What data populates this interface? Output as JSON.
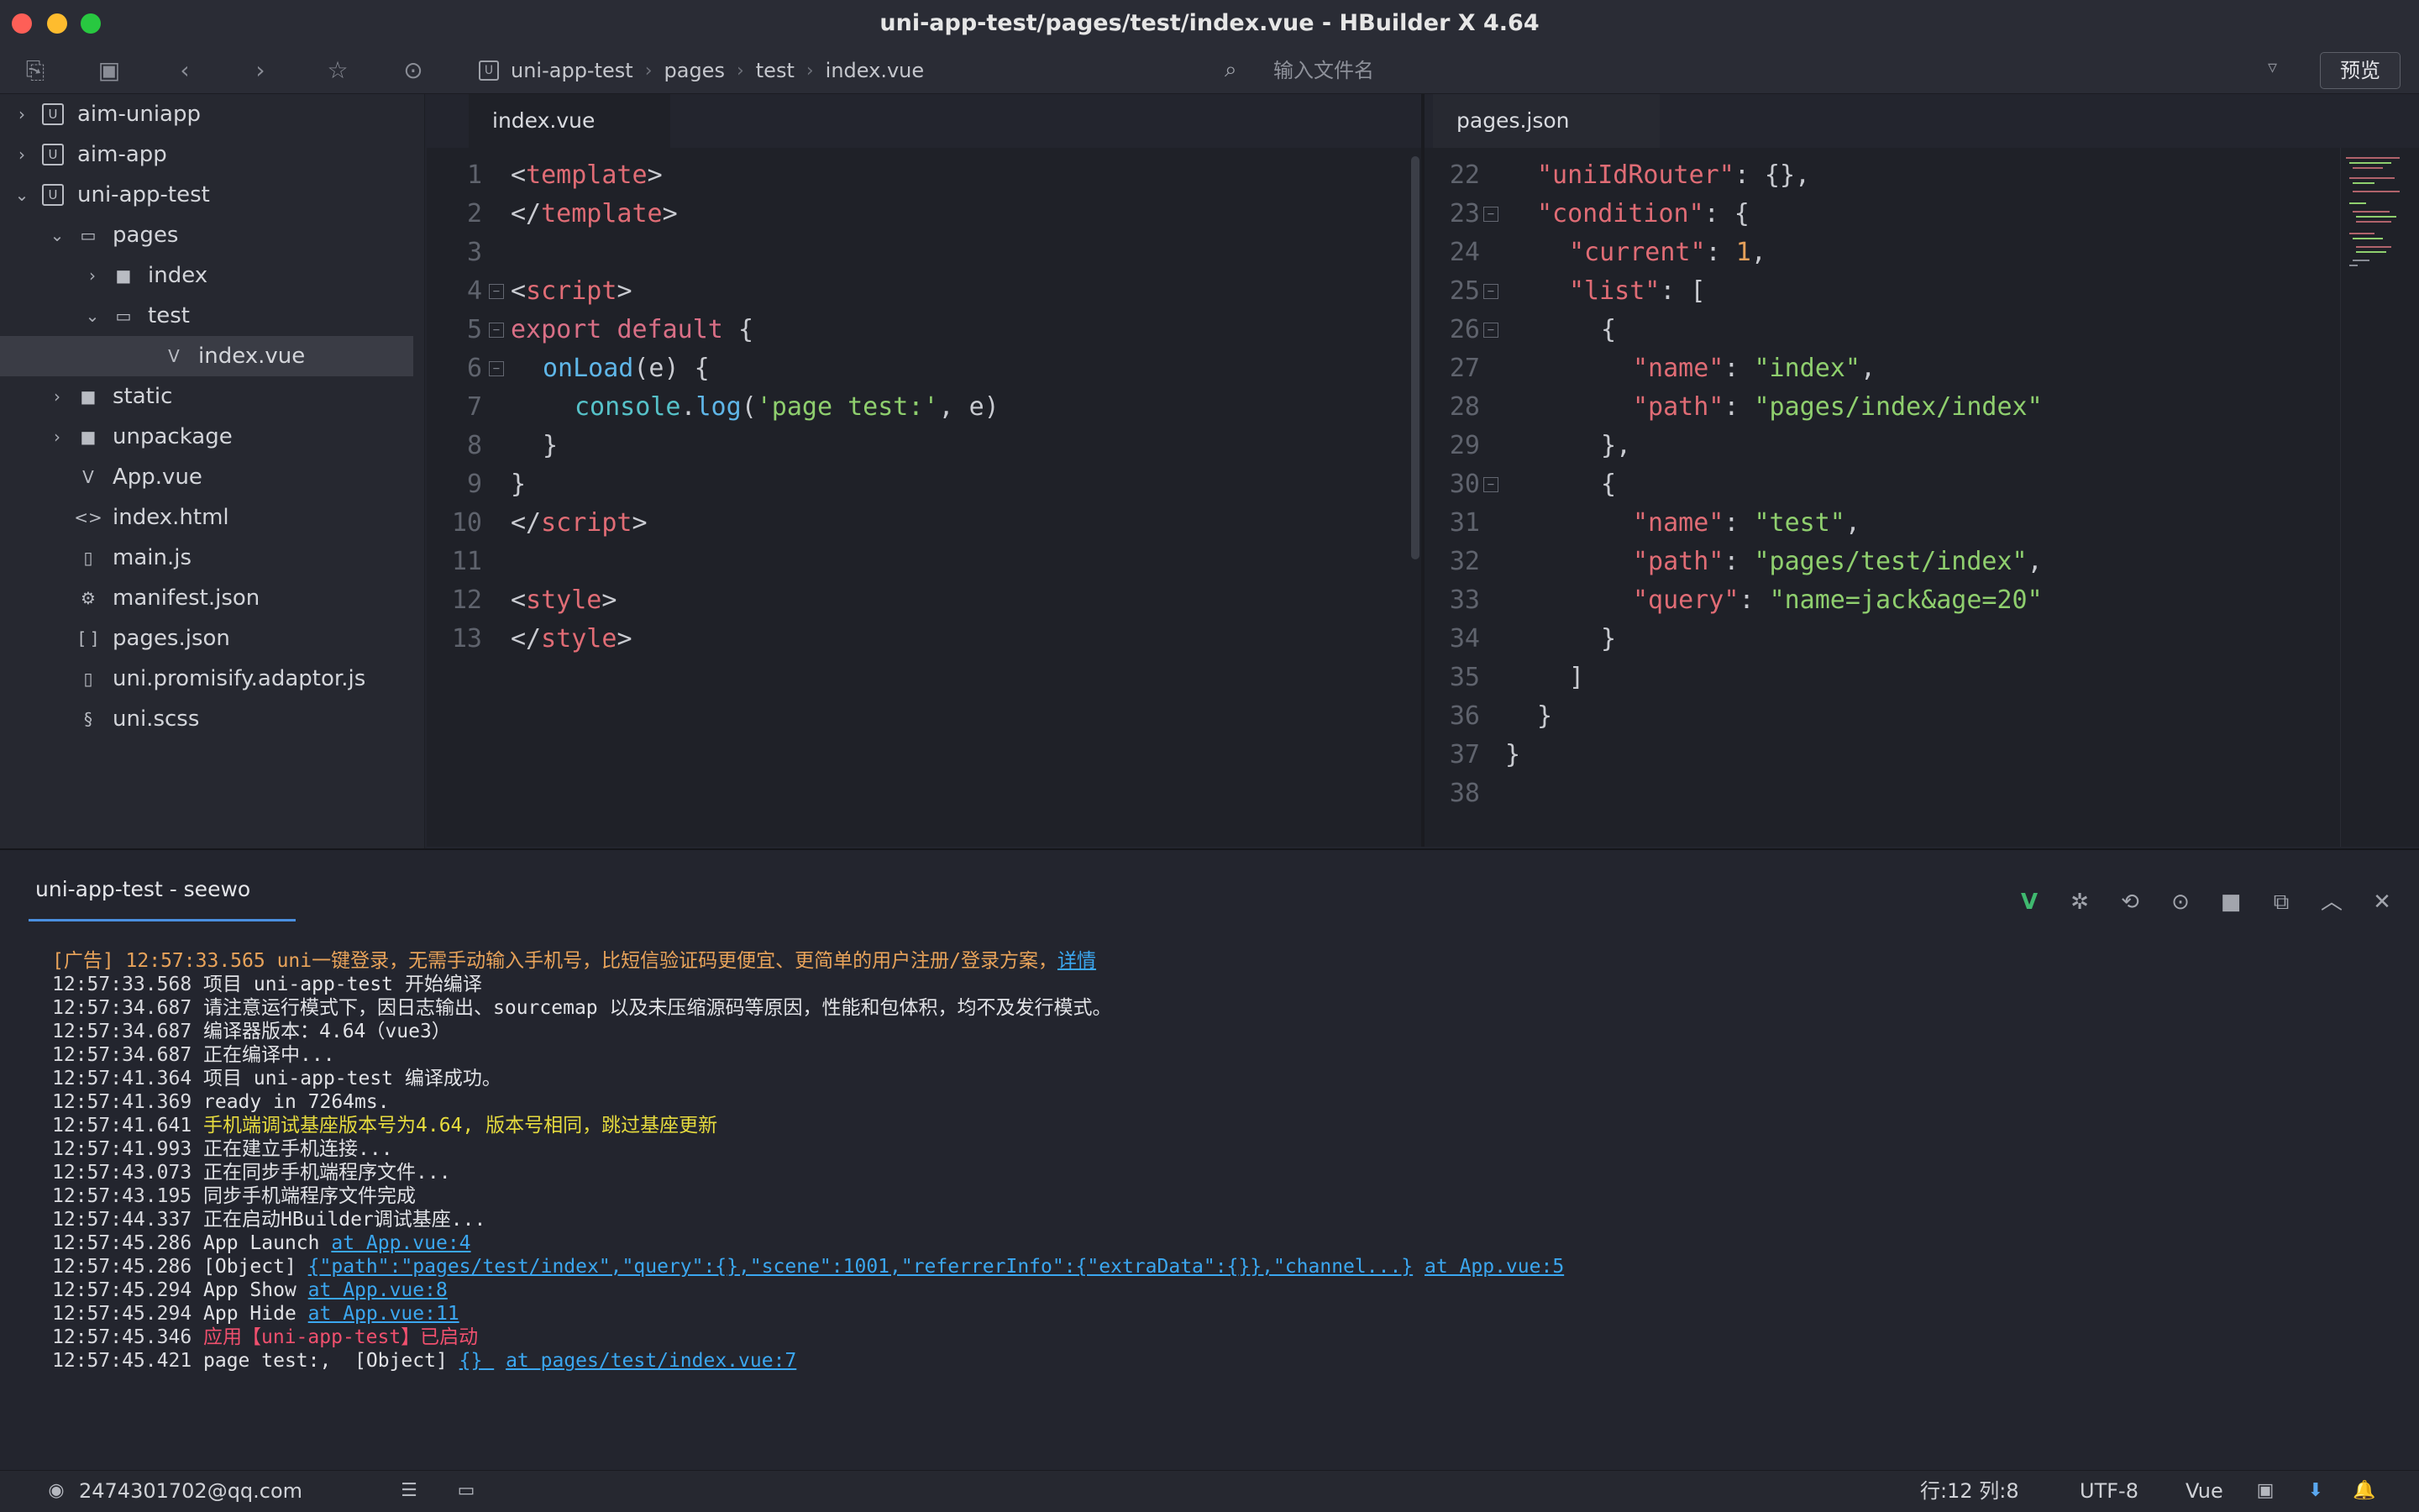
{
  "window": {
    "title": "uni-app-test/pages/test/index.vue - HBuilder X 4.64",
    "traffic_colors": {
      "close": "#fe5f57",
      "minimize": "#febc2e",
      "maximize": "#28c840"
    }
  },
  "toolbar": {
    "icons": [
      "new-file-icon",
      "save-icon",
      "back-icon",
      "forward-icon",
      "star-icon",
      "run-icon"
    ],
    "breadcrumb": [
      "uni-app-test",
      "pages",
      "test",
      "index.vue"
    ],
    "search_placeholder": "输入文件名",
    "preview_label": "预览"
  },
  "sidebar": {
    "items": [
      {
        "label": "aim-uniapp",
        "icon": "project-icon",
        "arrow": "›"
      },
      {
        "label": "aim-app",
        "icon": "project-icon",
        "arrow": "›"
      },
      {
        "label": "uni-app-test",
        "icon": "project-icon",
        "arrow": "⌄"
      },
      {
        "label": "pages",
        "icon": "folder-open-icon",
        "arrow": "⌄"
      },
      {
        "label": "index",
        "icon": "folder-icon",
        "arrow": "›"
      },
      {
        "label": "test",
        "icon": "folder-open-icon",
        "arrow": "⌄"
      },
      {
        "label": "index.vue",
        "icon": "vue-file-icon",
        "arrow": ""
      },
      {
        "label": "static",
        "icon": "folder-icon",
        "arrow": "›"
      },
      {
        "label": "unpackage",
        "icon": "folder-icon",
        "arrow": "›"
      },
      {
        "label": "App.vue",
        "icon": "vue-file-icon",
        "arrow": ""
      },
      {
        "label": "index.html",
        "icon": "html-file-icon",
        "arrow": ""
      },
      {
        "label": "main.js",
        "icon": "js-file-icon",
        "arrow": ""
      },
      {
        "label": "manifest.json",
        "icon": "manifest-file-icon",
        "arrow": ""
      },
      {
        "label": "pages.json",
        "icon": "json-file-icon",
        "arrow": ""
      },
      {
        "label": "uni.promisify.adaptor.js",
        "icon": "js-file-icon",
        "arrow": ""
      },
      {
        "label": "uni.scss",
        "icon": "scss-file-icon",
        "arrow": ""
      }
    ],
    "tools": [
      "project-manager-icon",
      "find-icon",
      "debug-icon",
      "git-icon",
      "cloud-icon"
    ]
  },
  "editor_left": {
    "tab": "index.vue",
    "line_numbers": [
      "1",
      "2",
      "3",
      "4",
      "5",
      "6",
      "7",
      "8",
      "9",
      "10",
      "11",
      "12",
      "13"
    ],
    "lines": {
      "l1_open": "<",
      "l1_tag": "template",
      "l1_close": ">",
      "l2_open": "</",
      "l2_tag": "template",
      "l2_close": ">",
      "l4_open": "<",
      "l4_tag": "script",
      "l4_close": ">",
      "l5_kw1": "export",
      "l5_kw2": "default",
      "l5_brace": "{",
      "l6_fn": "onLoad",
      "l6_args": "(e) {",
      "l7_obj": "console",
      "l7_dot": ".",
      "l7_fn": "log",
      "l7_p1": "(",
      "l7_str": "'page test:'",
      "l7_rest": ", e)",
      "l8": "}",
      "l9": "}",
      "l10_open": "</",
      "l10_tag": "script",
      "l10_close": ">",
      "l12_open": "<",
      "l12_tag": "style",
      "l12_close": ">",
      "l13_open": "</",
      "l13_tag": "style",
      "l13_close": ">"
    }
  },
  "editor_right": {
    "tab": "pages.json",
    "line_numbers": [
      "22",
      "23",
      "24",
      "25",
      "26",
      "27",
      "28",
      "29",
      "30",
      "31",
      "32",
      "33",
      "34",
      "35",
      "36",
      "37",
      "38"
    ],
    "lines": {
      "l22_key": "\"uniIdRouter\"",
      "l22_rest": ": {},",
      "l23_key": "\"condition\"",
      "l23_rest": ": {",
      "l24_key": "\"current\"",
      "l24_colon": ": ",
      "l24_num": "1",
      "l24_comma": ",",
      "l25_key": "\"list\"",
      "l25_rest": ": [",
      "l26": "{",
      "l27_key": "\"name\"",
      "l27_colon": ": ",
      "l27_val": "\"index\"",
      "l27_comma": ",",
      "l28_key": "\"path\"",
      "l28_colon": ": ",
      "l28_val": "\"pages/index/index\"",
      "l29": "},",
      "l30": "{",
      "l31_key": "\"name\"",
      "l31_colon": ": ",
      "l31_val": "\"test\"",
      "l31_comma": ",",
      "l32_key": "\"path\"",
      "l32_colon": ": ",
      "l32_val": "\"pages/test/index\"",
      "l32_comma": ",",
      "l33_key": "\"query\"",
      "l33_colon": ": ",
      "l33_val": "\"name=jack&age=20\"",
      "l34": "}",
      "l35": "]",
      "l36": "}",
      "l37": "}"
    }
  },
  "console": {
    "tab": "uni-app-test - seewo",
    "icons": [
      "vue-icon",
      "debug-icon",
      "restart-icon",
      "run-icon",
      "stop-icon",
      "open-external-icon",
      "collapse-icon",
      "clear-icon"
    ],
    "logs": [
      {
        "ts": "[广告] 12:57:33.565",
        "msg": " uni一键登录，无需手动输入手机号，比短信验证码更便宜、更简单的用户注册/登录方案，",
        "link": "详情"
      },
      {
        "ts": "12:57:33.568",
        "msg": " 项目 uni-app-test 开始编译"
      },
      {
        "ts": "12:57:34.687",
        "msg": " 请注意运行模式下，因日志输出、sourcemap 以及未压缩源码等原因，性能和包体积，均不及发行模式。"
      },
      {
        "ts": "12:57:34.687",
        "msg": " 编译器版本：4.64（vue3）"
      },
      {
        "ts": "12:57:34.687",
        "msg": " 正在编译中..."
      },
      {
        "ts": "12:57:41.364",
        "msg": " 项目 uni-app-test 编译成功。"
      },
      {
        "ts": "12:57:41.369",
        "msg": " ready in 7264ms."
      },
      {
        "ts": "12:57:41.641",
        "msg": " 手机端调试基座版本号为4.64, 版本号相同，跳过基座更新"
      },
      {
        "ts": "12:57:41.993",
        "msg": " 正在建立手机连接..."
      },
      {
        "ts": "12:57:43.073",
        "msg": " 正在同步手机端程序文件..."
      },
      {
        "ts": "12:57:43.195",
        "msg": " 同步手机端程序文件完成"
      },
      {
        "ts": "12:57:44.337",
        "msg": " 正在启动HBuilder调试基座..."
      },
      {
        "ts": "12:57:45.286",
        "msg": " App Launch ",
        "link": "at App.vue:4"
      },
      {
        "ts": "12:57:45.286",
        "msg": " [Object] ",
        "link": "{\"path\":\"pages/test/index\",\"query\":{},\"scene\":1001,\"referrerInfo\":{\"extraData\":{}},\"channel...}",
        "link2": "at App.vue:5"
      },
      {
        "ts": "12:57:45.294",
        "msg": " App Show ",
        "link": "at App.vue:8"
      },
      {
        "ts": "12:57:45.294",
        "msg": " App Hide ",
        "link": "at App.vue:11"
      },
      {
        "ts": "12:57:45.346",
        "msg": " 应用【uni-app-test】已启动"
      },
      {
        "ts": "12:57:45.421",
        "msg": " page test:,  [Object] ",
        "link": "{} ",
        "link2": "at pages/test/index.vue:7"
      }
    ]
  },
  "statusbar": {
    "account": "2474301702@qq.com",
    "position": "行:12  列:8",
    "encoding": "UTF-8",
    "language": "Vue"
  }
}
